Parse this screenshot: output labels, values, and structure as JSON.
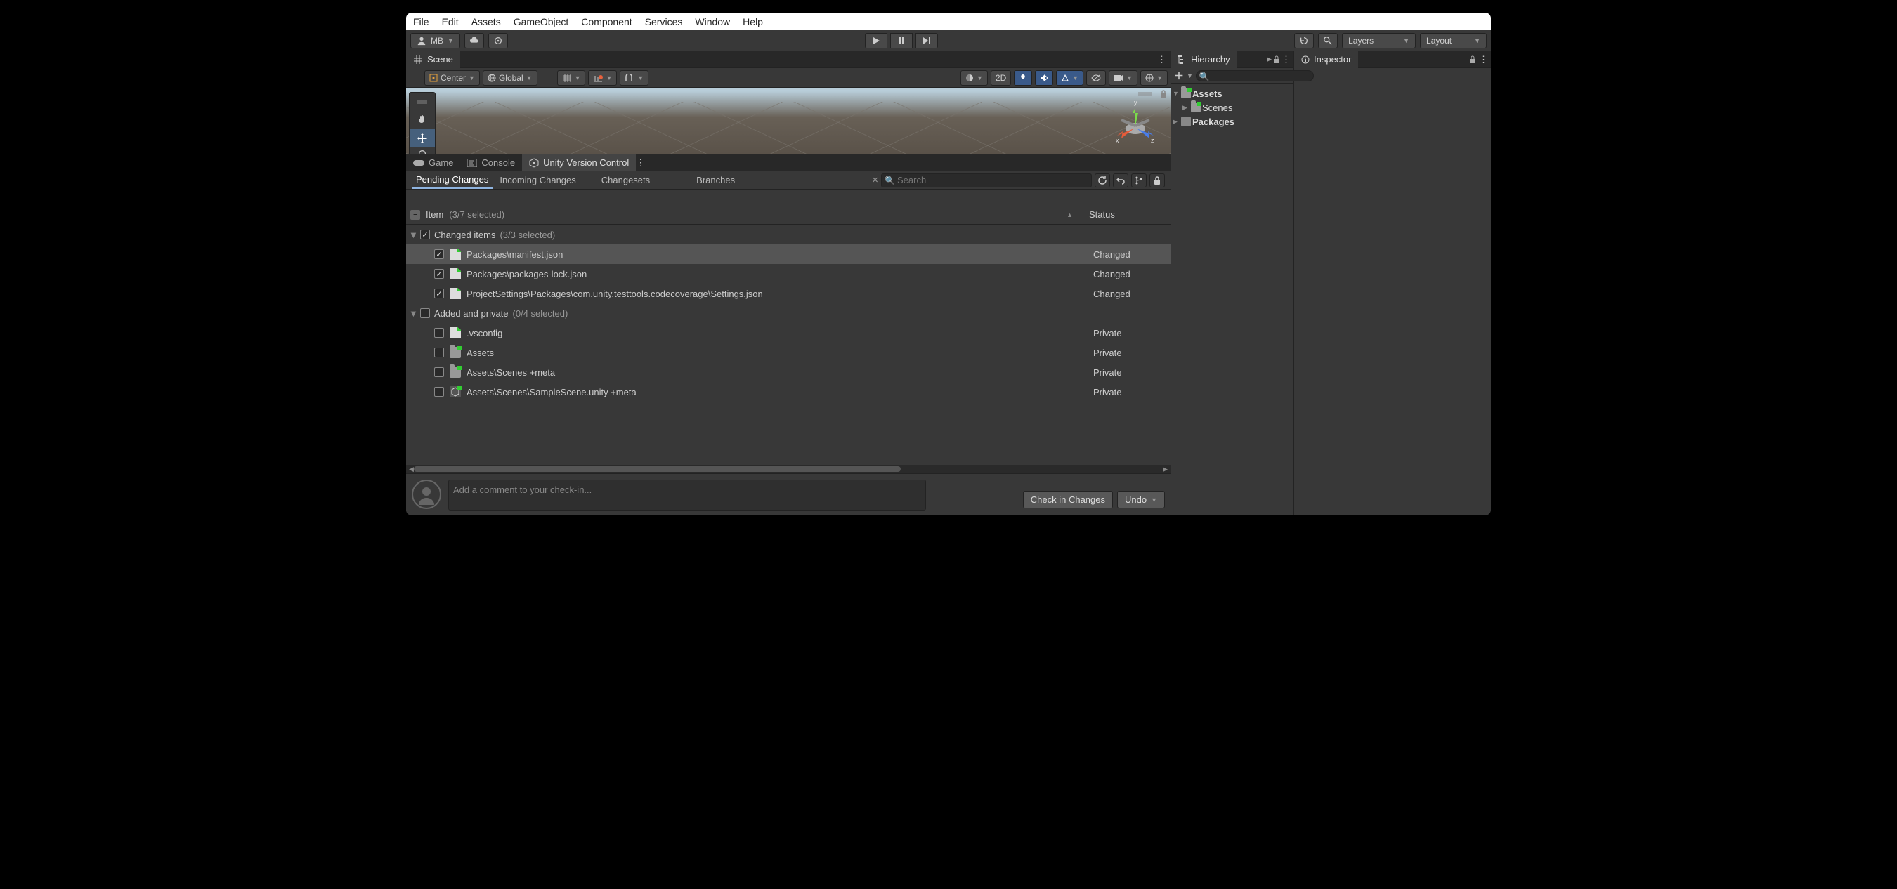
{
  "menu": {
    "file": "File",
    "edit": "Edit",
    "assets": "Assets",
    "gameObject": "GameObject",
    "component": "Component",
    "services": "Services",
    "window": "Window",
    "help": "Help"
  },
  "toolbar": {
    "account": "MB",
    "layers": "Layers",
    "layout": "Layout"
  },
  "sceneTab": "Scene",
  "pivot": "Center",
  "handle": "Global",
  "mode2d": "2D",
  "gizmoAxes": {
    "x": "x",
    "y": "y",
    "z": "z"
  },
  "lowerTabs": {
    "game": "Game",
    "console": "Console",
    "uvc": "Unity Version Control"
  },
  "subtabs": {
    "pending": "Pending Changes",
    "incoming": "Incoming Changes",
    "changesets": "Changesets",
    "branches": "Branches"
  },
  "search": {
    "placeholder": "Search",
    "close": "×"
  },
  "columns": {
    "item": "Item",
    "itemCount": "(3/7 selected)",
    "status": "Status"
  },
  "groups": {
    "changed": {
      "label": "Changed items",
      "count": "(3/3 selected)"
    },
    "added": {
      "label": "Added and private",
      "count": "(0/4 selected)"
    }
  },
  "rows": {
    "r1": {
      "name": "Packages\\manifest.json",
      "status": "Changed"
    },
    "r2": {
      "name": "Packages\\packages-lock.json",
      "status": "Changed"
    },
    "r3": {
      "name": "ProjectSettings\\Packages\\com.unity.testtools.codecoverage\\Settings.json",
      "status": "Changed"
    },
    "r4": {
      "name": ".vsconfig",
      "status": "Private"
    },
    "r5": {
      "name": "Assets",
      "status": "Private"
    },
    "r6": {
      "name": "Assets\\Scenes +meta",
      "status": "Private"
    },
    "r7": {
      "name": "Assets\\Scenes\\SampleScene.unity +meta",
      "status": "Private"
    }
  },
  "checkin": {
    "placeholder": "Add a comment to your check-in...",
    "button": "Check in Changes",
    "undo": "Undo"
  },
  "hierarchy": {
    "tab": "Hierarchy",
    "assets": "Assets",
    "scenes": "Scenes",
    "packages": "Packages"
  },
  "inspector": {
    "tab": "Inspector"
  }
}
